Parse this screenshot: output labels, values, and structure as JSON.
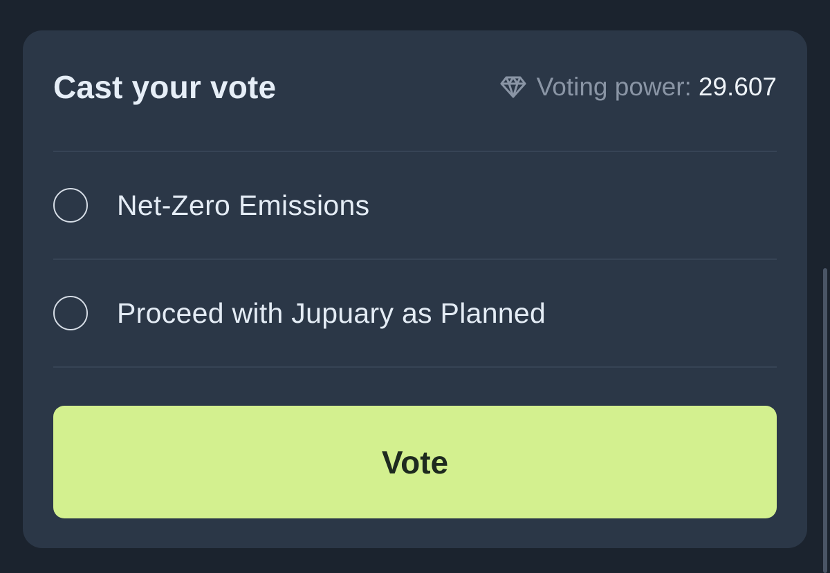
{
  "card": {
    "title": "Cast your vote",
    "voting_power_label": "Voting power:",
    "voting_power_value": "29.607",
    "voting_power_icon": "diamond-icon"
  },
  "options": [
    {
      "label": "Net-Zero Emissions",
      "selected": false
    },
    {
      "label": "Proceed with Jupuary as Planned",
      "selected": false
    }
  ],
  "vote_button": {
    "label": "Vote"
  },
  "colors": {
    "background": "#1b232e",
    "card": "#2b3747",
    "accent": "#d3f08f",
    "text": "#e4ecf5",
    "muted": "#8a95a5"
  }
}
